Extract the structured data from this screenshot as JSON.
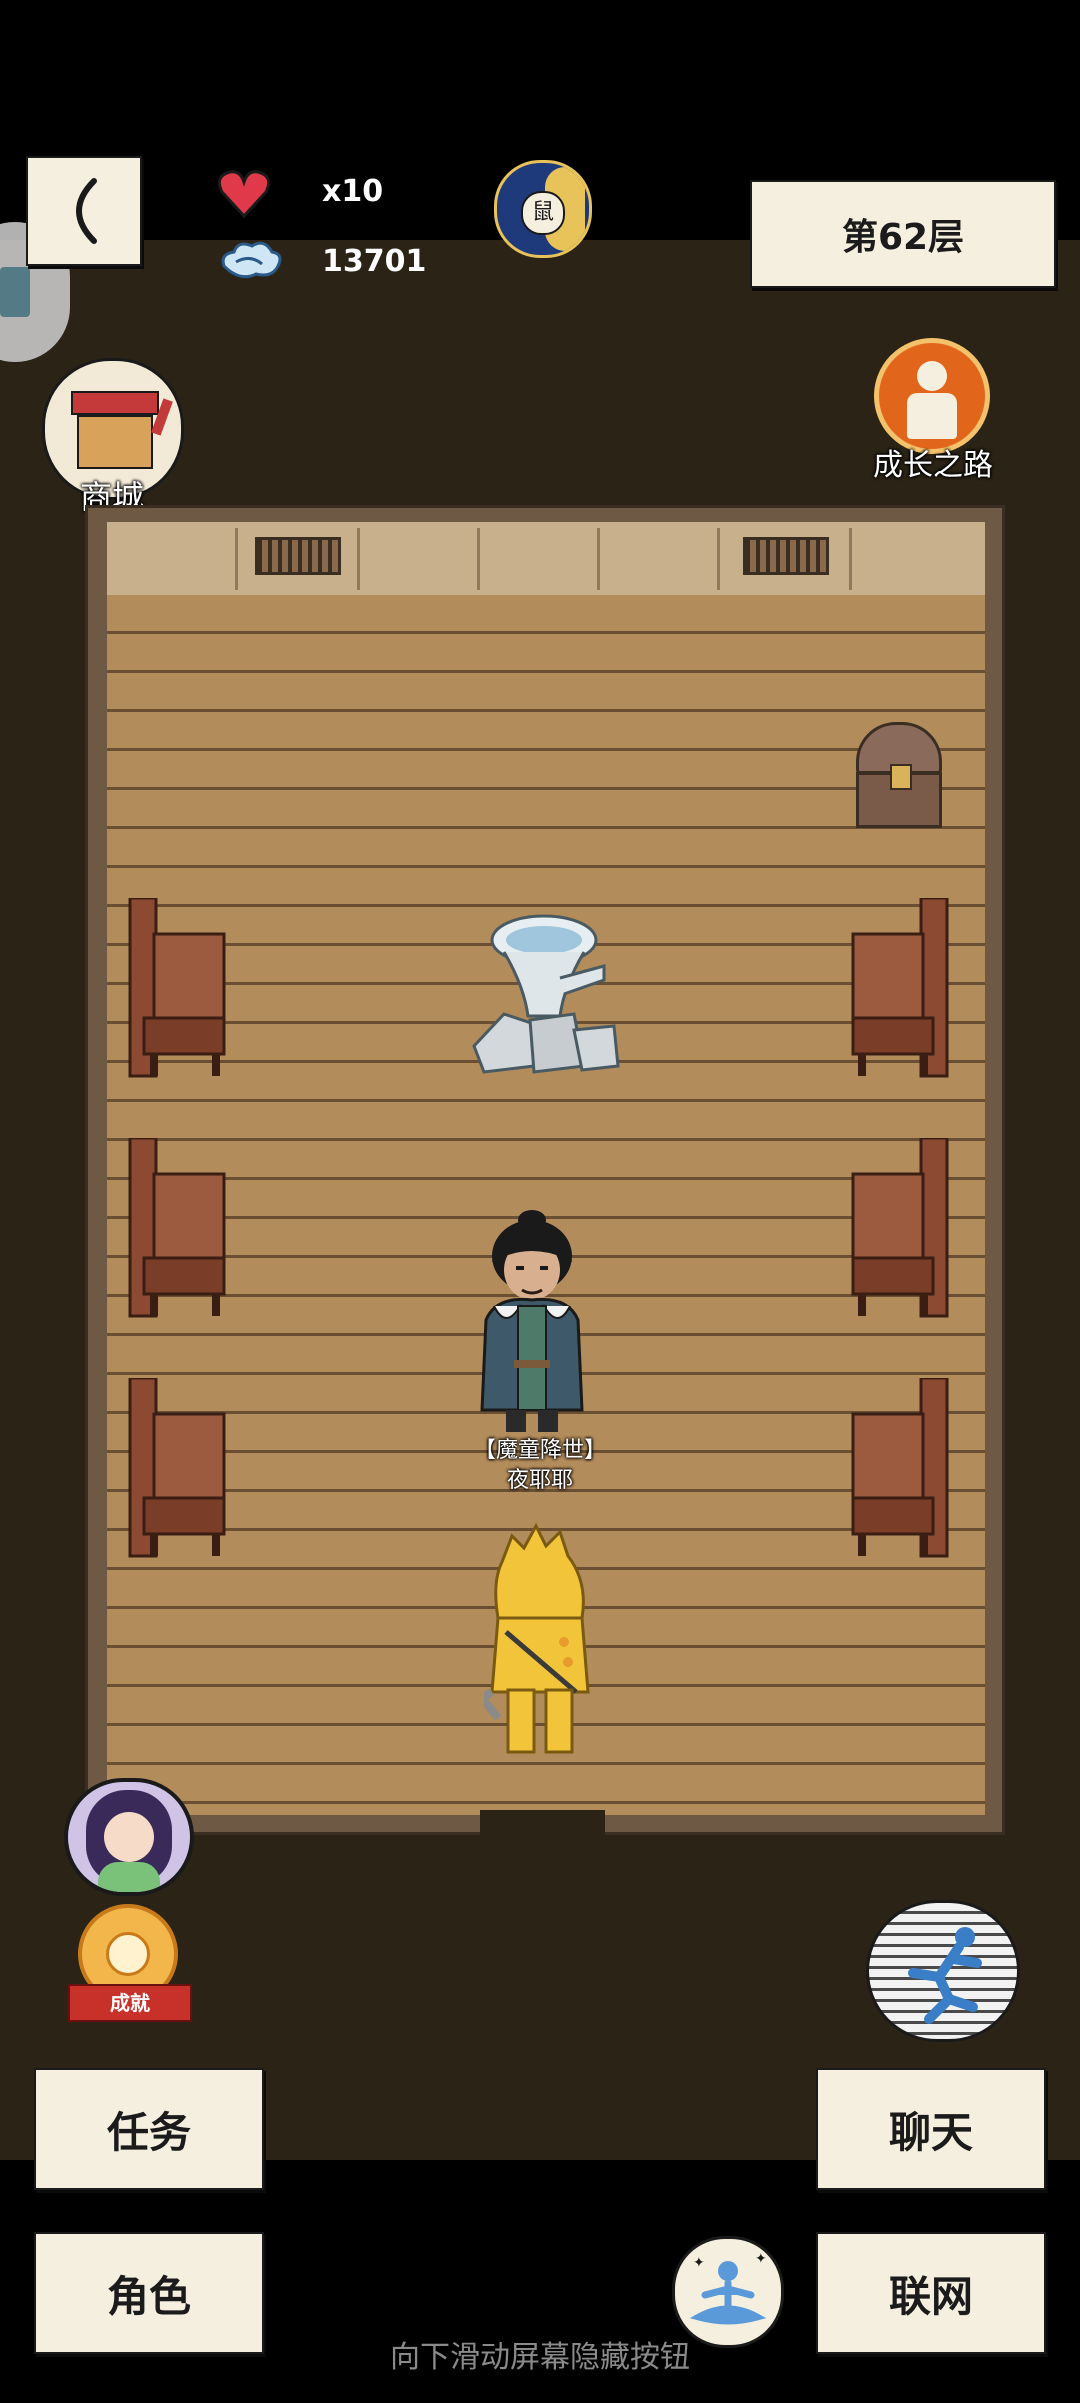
{
  "hud": {
    "hearts": "x10",
    "currency": "13701",
    "floor_label": "第62层"
  },
  "shortcuts": {
    "shop_label": "商城",
    "growth_label": "成长之路",
    "achievement_badge": "成就"
  },
  "npc": {
    "title": "【魔童降世】",
    "name": "夜耶耶"
  },
  "buttons": {
    "tasks": "任务",
    "character": "角色",
    "chat": "聊天",
    "network": "联网"
  },
  "hint": "向下滑动屏幕隐藏按钮",
  "colors": {
    "paper": "#f5efdf",
    "floor": "#b38c5c",
    "background": "#2b2416",
    "heart": "#e03a4a",
    "growth_orange": "#e2651c"
  },
  "icons": [
    "back-icon",
    "heart-icon",
    "cloud-icon",
    "zodiac-rat-moon-icon",
    "shop-stall-icon",
    "growth-road-icon",
    "achievement-medal-icon",
    "running-figure-icon",
    "meditation-figure-icon",
    "companion-avatar"
  ]
}
